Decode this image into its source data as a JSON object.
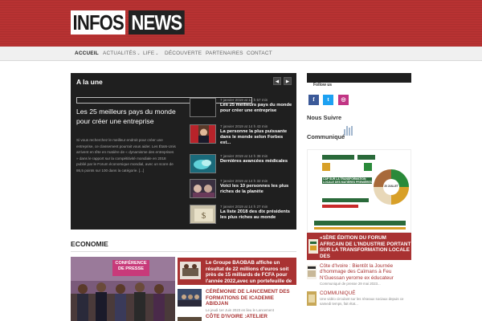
{
  "header": {
    "logo_part1": "INFOS",
    "logo_part2": "NEWS"
  },
  "nav": {
    "items": [
      {
        "label": "ACCUEIL",
        "active": true
      },
      {
        "label": "ACTUALITÉS",
        "dropdown": true
      },
      {
        "label": "LIFE",
        "dropdown": true
      },
      {
        "label": "DÉCOUVERTE"
      },
      {
        "label": "PARTENAIRES"
      },
      {
        "label": "CONTACT"
      }
    ]
  },
  "slider": {
    "title": "A la une",
    "prev_icon": "◀",
    "next_icon": "▶",
    "featured": {
      "title": "Les 25 meilleurs pays du monde pour créer une entreprise",
      "excerpt": "Si vous recherchez le meilleur endroit pour créer une entreprise, ce classement pourrait vous aider. Les États-Unis arrivent en tête en matière de « dynamisme des entreprises » dans le rapport sur la compétitivité mondiale en 2018 publié par le Forum économique mondial, avec un score de 86,5 points sur 100 dans la catégorie. [...]"
    },
    "items": [
      {
        "date": "7 janvier 2019 at 14 h 57 min",
        "title": "Les 25 meilleurs pays du monde pour créer une entreprise"
      },
      {
        "date": "7 janvier 2019 at 14 h 43 min",
        "title": "La personne la plus puissante dans le monde selon Forbes est..."
      },
      {
        "date": "7 janvier 2019 at 14 h 38 min",
        "title": "Dernières avancées médicales"
      },
      {
        "date": "7 janvier 2019 at 14 h 32 min",
        "title": "Voici les 10 personnes les plus riches de la planète"
      },
      {
        "date": "7 janvier 2019 at 14 h 27 min",
        "title": "La liste 2018 des dix présidents les plus riches au monde"
      }
    ]
  },
  "economie": {
    "title": "ECONOMIE",
    "image_text": "CONFÉRENCE DE PRESSE",
    "banner": "Le Groupe BAOBAB affiche un résultat de 22 millions d'euros soit près de 15 milliards de FCFA pour l'année 2022,avec un portefeuille de",
    "items": [
      {
        "title": "CÉRÉMONIE DE LANCEMENT DES FORMATIONS DE ICADEMIE ABIDJAN",
        "date": "Le jeudi 1er Juin 2023 en lieu le Lancement"
      },
      {
        "title": "CÔTE D'IVOIRE :ATELIER"
      }
    ]
  },
  "sidebar": {
    "follow_label": "Follow us",
    "social": [
      {
        "icon": "facebook-icon",
        "glyph": "f",
        "color": "#3b5998"
      },
      {
        "icon": "twitter-icon",
        "glyph": "t",
        "color": "#1da1f2"
      },
      {
        "icon": "instagram-icon",
        "glyph": "◎",
        "color": "#c13584"
      }
    ],
    "nous_suivre": "Nous Suivre",
    "communique": "Communiqué",
    "ad": {
      "headline": "CAP SUR LA TRANSFORMATION LOCALE DES MATIÈRES PREMIÈRES",
      "date_label": "20 JUILLET"
    },
    "banner": "«1ÈRE ÉDITION DU FORUM AFRICAIN DE L'INDUSTRIE PORTANT SUR LA TRANSFORMATION LOCALE DES",
    "items": [
      {
        "title": "Côte d'Ivoire : Bientôt la Journée d'hommage des Caïmans à Feu N'Guessan yerome ex éducateur",
        "sub": "Communiqué de presse 29 mai 2023..."
      },
      {
        "title": "COMMUNIQUÉ",
        "sub": "Une vidéo circulant sur les réseaux sociaux depuis ce samedi temps, fait état..."
      }
    ]
  }
}
